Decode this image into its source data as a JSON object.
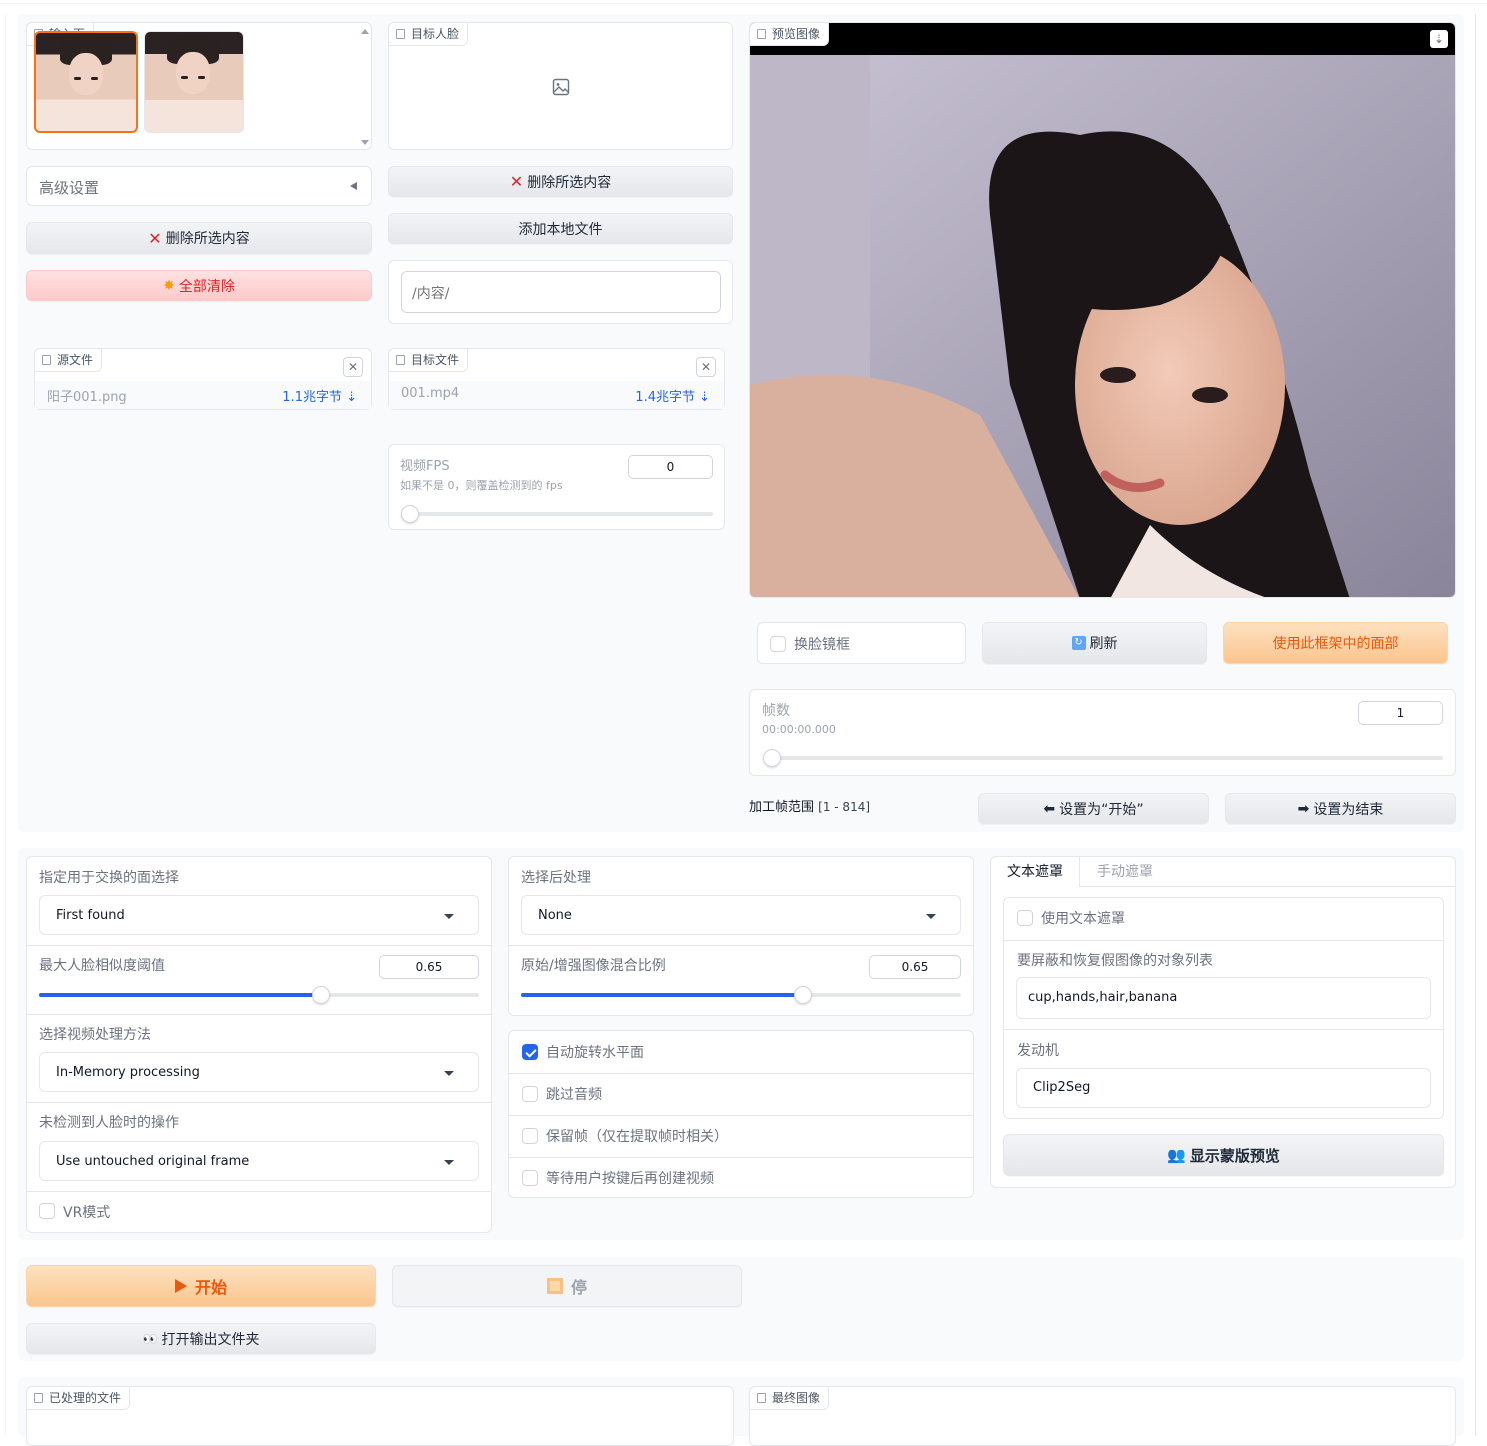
{
  "input_face": {
    "label": "输入面"
  },
  "target_face": {
    "label": "目标人脸"
  },
  "preview": {
    "label": "预览图像"
  },
  "advanced": {
    "label": "高级设置"
  },
  "left_buttons": {
    "delete_selected": "删除所选内容",
    "clear_all": "全部清除"
  },
  "mid_buttons": {
    "delete_selected": "删除所选内容",
    "add_local": "添加本地文件"
  },
  "path_input": {
    "placeholder": "/内容/"
  },
  "source_file": {
    "label": "源文件",
    "name": "阳子001.png",
    "size": "1.1兆字节 ⇣"
  },
  "target_file": {
    "label": "目标文件",
    "name": "001.mp4",
    "size": "1.4兆字节 ⇣"
  },
  "fps": {
    "label": "视频FPS",
    "info": "如果不是 0，则覆盖检测到的 fps",
    "value": "0"
  },
  "preview_controls": {
    "face_frame": "换脸镜框",
    "refresh": "刷新",
    "use_face": "使用此框架中的面部"
  },
  "frames": {
    "label": "帧数",
    "timecode": "00:00:00.000",
    "value": "1"
  },
  "range": {
    "label": "加工帧范围",
    "value": "[1 - 814]",
    "set_start": "设置为“开始”",
    "set_end": "设置为结束"
  },
  "settings_left": {
    "face_select_label": "指定用于交换的面选择",
    "face_select_value": "First found",
    "similarity_label": "最大人脸相似度阈值",
    "similarity_value": "0.65",
    "video_method_label": "选择视频处理方法",
    "video_method_value": "In-Memory processing",
    "no_face_label": "未检测到人脸时的操作",
    "no_face_value": "Use untouched original frame",
    "vr_label": "VR模式"
  },
  "settings_mid": {
    "post_label": "选择后处理",
    "post_value": "None",
    "blend_label": "原始/增强图像混合比例",
    "blend_value": "0.65",
    "auto_rotate": "自动旋转水平面",
    "skip_audio": "跳过音频",
    "keep_frames": "保留帧（仅在提取帧时相关）",
    "wait_user": "等待用户按键后再创建视频"
  },
  "mask": {
    "tab_text": "文本遮罩",
    "tab_manual": "手动遮罩",
    "use_text_mask": "使用文本遮罩",
    "objects_label": "要屏蔽和恢复假图像的对象列表",
    "objects_value": "cup,hands,hair,banana",
    "engine_label": "发动机",
    "engine_value": "Clip2Seg",
    "show_preview": "显示蒙版预览"
  },
  "run": {
    "start": "开始",
    "stop": "停",
    "open_output": "打开输出文件夹"
  },
  "bottom": {
    "processed_files": "已处理的文件",
    "final_image": "最终图像"
  },
  "colors": {
    "accent": "#ea580c",
    "blue": "#2563eb"
  }
}
